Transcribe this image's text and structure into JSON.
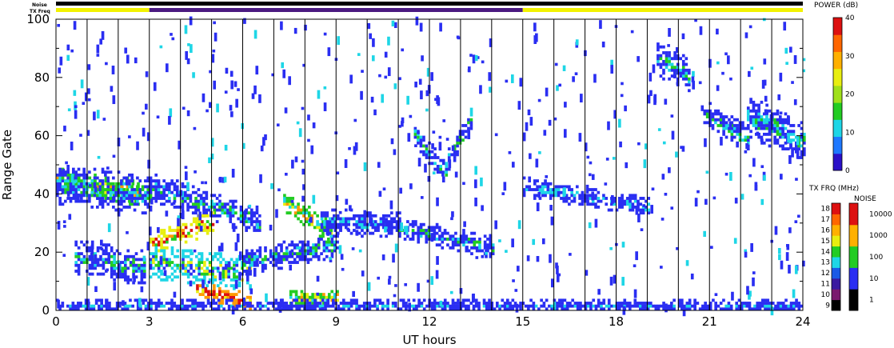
{
  "header": {
    "noise_label": "Noise",
    "txfreq_label": "TX Freq"
  },
  "chart_data": {
    "type": "heatmap",
    "xlabel": "UT hours",
    "ylabel": "Range Gate",
    "xlim": [
      0,
      24
    ],
    "ylim": [
      0,
      100
    ],
    "x_ticks": [
      "0",
      "3",
      "6",
      "9",
      "12",
      "15",
      "18",
      "21",
      "24"
    ],
    "y_ticks": [
      "0",
      "20",
      "40",
      "60",
      "80",
      "100"
    ],
    "grid": "vertical lines every 1 hour",
    "colors": {
      "blue": "#2a2ef2",
      "cyan": "#1ed6e6",
      "green": "#22cc22",
      "yellow": "#e8ee10",
      "orange": "#ff9900",
      "red": "#dd1010",
      "tx_yellow": "#f2f200",
      "tx_purple": "#4b1a80"
    },
    "noise_bar": {
      "level": "1",
      "color": "#000000",
      "x_range": [
        0,
        24
      ]
    },
    "tx_freq_bar": [
      {
        "x_range": [
          0,
          3
        ],
        "mhz": "14",
        "color": "#f2f200"
      },
      {
        "x_range": [
          3,
          15
        ],
        "mhz": "11",
        "color": "#4b1a80"
      },
      {
        "x_range": [
          15,
          24
        ],
        "mhz": "14",
        "color": "#f2f200"
      }
    ],
    "scatter_bands": [
      {
        "x_start": 0,
        "x_end": 2.6,
        "y_start": 44,
        "y_end": 40,
        "width": 7,
        "level": "yellow"
      },
      {
        "x_start": 0,
        "x_end": 3,
        "y_start": 43,
        "y_end": 39,
        "width": 12,
        "level": "cyan"
      },
      {
        "x_start": 3,
        "x_end": 6.5,
        "y_start": 42,
        "y_end": 30,
        "width": 8,
        "level": "cyan"
      },
      {
        "x_start": 0.6,
        "x_end": 2.8,
        "y_start": 18,
        "y_end": 14,
        "width": 10,
        "level": "cyan"
      },
      {
        "x_start": 3,
        "x_end": 5,
        "y_start": 22,
        "y_end": 30,
        "width": 6,
        "level": "orange"
      },
      {
        "x_start": 3,
        "x_end": 6.2,
        "y_start": 16,
        "y_end": 12,
        "width": 10,
        "level": "green"
      },
      {
        "x_start": 4.5,
        "x_end": 6.2,
        "y_start": 7,
        "y_end": 2,
        "width": 4,
        "level": "red"
      },
      {
        "x_start": 6,
        "x_end": 9,
        "y_start": 16,
        "y_end": 22,
        "width": 7,
        "level": "cyan"
      },
      {
        "x_start": 7.3,
        "x_end": 8.8,
        "y_start": 37,
        "y_end": 26,
        "width": 6,
        "level": "yellow"
      },
      {
        "x_start": 8.5,
        "x_end": 11,
        "y_start": 30,
        "y_end": 29,
        "width": 7,
        "level": "blue"
      },
      {
        "x_start": 11,
        "x_end": 14,
        "y_start": 28,
        "y_end": 21,
        "width": 6,
        "level": "cyan"
      },
      {
        "x_start": 7.5,
        "x_end": 9,
        "y_start": 4,
        "y_end": 4,
        "width": 4,
        "level": "yellow"
      },
      {
        "x_start": 11.5,
        "x_end": 12.5,
        "y_start": 60,
        "y_end": 46,
        "width": 6,
        "level": "cyan"
      },
      {
        "x_start": 12.5,
        "x_end": 13.3,
        "y_start": 50,
        "y_end": 64,
        "width": 6,
        "level": "cyan"
      },
      {
        "x_start": 15,
        "x_end": 19,
        "y_start": 42,
        "y_end": 35,
        "width": 5,
        "level": "blue"
      },
      {
        "x_start": 19.3,
        "x_end": 20.3,
        "y_start": 86,
        "y_end": 80,
        "width": 10,
        "level": "cyan"
      },
      {
        "x_start": 20.8,
        "x_end": 22.2,
        "y_start": 68,
        "y_end": 58,
        "width": 8,
        "level": "cyan"
      },
      {
        "x_start": 22.2,
        "x_end": 24,
        "y_start": 66,
        "y_end": 58,
        "width": 12,
        "level": "cyan"
      },
      {
        "x_start": 0,
        "x_end": 24,
        "y_start": 1,
        "y_end": 1,
        "width": 3,
        "level": "blue"
      }
    ],
    "power_colorbar": {
      "title": "POWER (dB)",
      "ticks": [
        "0",
        "10",
        "20",
        "30",
        "40"
      ],
      "colors": [
        "#2a10c8",
        "#1e78ff",
        "#1ed6e6",
        "#22cc22",
        "#a0e01a",
        "#e8ee10",
        "#ffb000",
        "#ff6600",
        "#dd1010"
      ]
    },
    "txfreq_colorbar": {
      "title": "TX FRQ (MHz)",
      "levels": [
        "9",
        "10",
        "11",
        "12",
        "13",
        "14",
        "15",
        "16",
        "17",
        "18"
      ],
      "colors": [
        "#000000",
        "#7a1a6e",
        "#3a1aa0",
        "#1a5ae6",
        "#1ed6e6",
        "#22cc22",
        "#e8ee10",
        "#ffb000",
        "#ff6600",
        "#dd1010"
      ]
    },
    "noise_colorbar": {
      "title": "NOISE",
      "ticks": [
        "1",
        "10",
        "100",
        "1000",
        "10000"
      ],
      "colors": [
        "#000000",
        "#2a2ef2",
        "#22cc22",
        "#ffb000",
        "#dd1010"
      ]
    }
  }
}
